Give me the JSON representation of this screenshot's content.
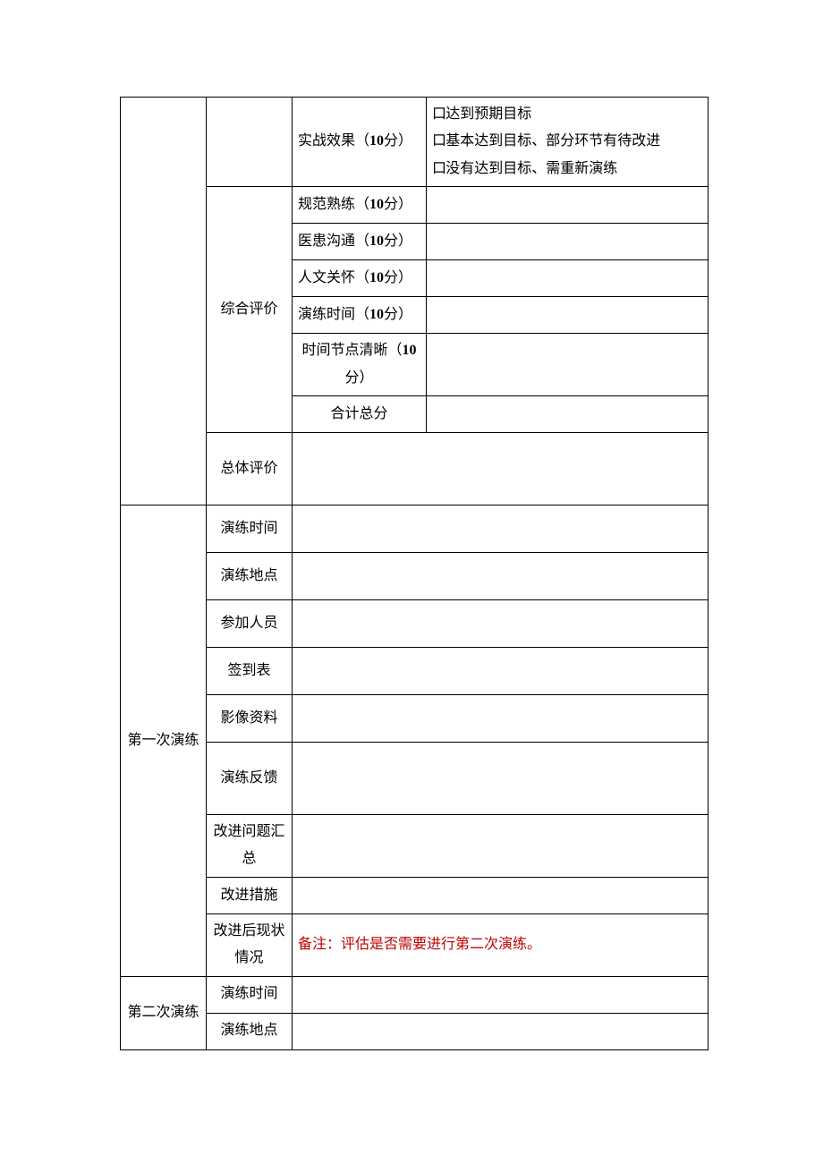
{
  "glyphs": {
    "box": "口"
  },
  "topSection": {
    "effect": {
      "label_prefix": "实战效果（",
      "label_points": "10",
      "label_suffix": "分）",
      "opts": [
        "达到预期目标",
        "基本达到目标、部分环节有待改进",
        "没有达到目标、需重新演练"
      ]
    },
    "comprehensive": {
      "label": "综合评价",
      "rows": [
        {
          "pre": "规范熟练（",
          "pts": "10",
          "suf": "分）"
        },
        {
          "pre": "医患沟通（",
          "pts": "10",
          "suf": "分）"
        },
        {
          "pre": "人文关怀（",
          "pts": "10",
          "suf": "分）"
        },
        {
          "pre": "演练时间（",
          "pts": "10",
          "suf": "分）"
        },
        {
          "pre": "时间节点清晰（",
          "pts": "10",
          "suf": "分）",
          "twoLine": true
        }
      ],
      "total": "合计总分"
    },
    "overall": "总体评价"
  },
  "drill1": {
    "title": "第一次演练",
    "rows": {
      "time": "演练时间",
      "place": "演练地点",
      "people": "参加人员",
      "signin": "签到表",
      "media": "影像资料",
      "feedback": "演练反馈",
      "issues": "改进问题汇总",
      "measures": "改进措施",
      "postStatus": "改进后现状情况",
      "postStatusNote": "备注：评估是否需要进行第二次演练。"
    }
  },
  "drill2": {
    "title": "第二次演练",
    "rows": {
      "time": "演练时间",
      "place": "演练地点"
    }
  }
}
